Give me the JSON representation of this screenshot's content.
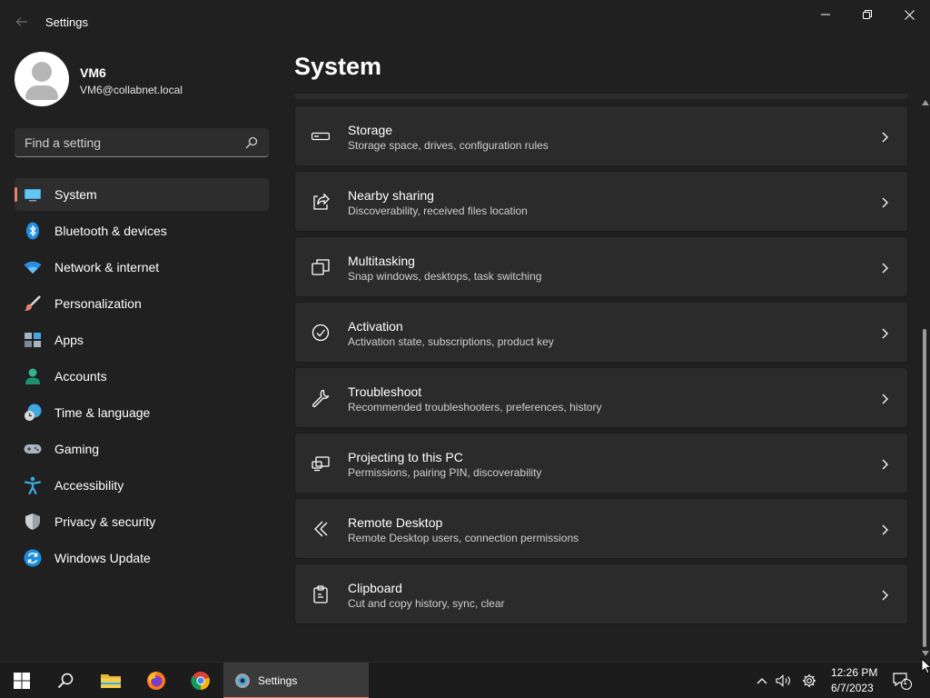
{
  "window": {
    "title": "Settings",
    "back_icon": "back-arrow-icon",
    "controls": [
      "minimize",
      "restore",
      "close"
    ]
  },
  "profile": {
    "name": "VM6",
    "email": "VM6@collabnet.local"
  },
  "search": {
    "placeholder": "Find a setting",
    "icon": "search-icon"
  },
  "sidebar": {
    "items": [
      {
        "label": "System",
        "icon": "system-icon",
        "active": true
      },
      {
        "label": "Bluetooth & devices",
        "icon": "bluetooth-icon"
      },
      {
        "label": "Network & internet",
        "icon": "wifi-icon"
      },
      {
        "label": "Personalization",
        "icon": "paintbrush-icon"
      },
      {
        "label": "Apps",
        "icon": "apps-icon"
      },
      {
        "label": "Accounts",
        "icon": "accounts-icon"
      },
      {
        "label": "Time & language",
        "icon": "clock-globe-icon"
      },
      {
        "label": "Gaming",
        "icon": "gamepad-icon"
      },
      {
        "label": "Accessibility",
        "icon": "accessibility-icon"
      },
      {
        "label": "Privacy & security",
        "icon": "shield-icon"
      },
      {
        "label": "Windows Update",
        "icon": "update-icon"
      }
    ],
    "accent_color": "#e8806c"
  },
  "main": {
    "title": "System",
    "cards": [
      {
        "title": "Storage",
        "subtitle": "Storage space, drives, configuration rules",
        "icon": "storage-icon"
      },
      {
        "title": "Nearby sharing",
        "subtitle": "Discoverability, received files location",
        "icon": "share-icon"
      },
      {
        "title": "Multitasking",
        "subtitle": "Snap windows, desktops, task switching",
        "icon": "multitasking-icon"
      },
      {
        "title": "Activation",
        "subtitle": "Activation state, subscriptions, product key",
        "icon": "checkmark-circle-icon"
      },
      {
        "title": "Troubleshoot",
        "subtitle": "Recommended troubleshooters, preferences, history",
        "icon": "wrench-icon"
      },
      {
        "title": "Projecting to this PC",
        "subtitle": "Permissions, pairing PIN, discoverability",
        "icon": "projecting-icon"
      },
      {
        "title": "Remote Desktop",
        "subtitle": "Remote Desktop users, connection permissions",
        "icon": "remote-desktop-icon"
      },
      {
        "title": "Clipboard",
        "subtitle": "Cut and copy history, sync, clear",
        "icon": "clipboard-icon"
      }
    ]
  },
  "taskbar": {
    "apps": [
      "start-icon",
      "search-icon",
      "file-explorer-icon",
      "firefox-icon",
      "chrome-icon"
    ],
    "active_app_label": "Settings",
    "tray_icons": [
      "chevron-up-icon",
      "volume-icon",
      "gear-icon",
      "notification-icon"
    ],
    "time": "12:26 PM",
    "date": "6/7/2023",
    "notification_count": "1"
  },
  "colors": {
    "background": "#202020",
    "card": "#2b2b2b",
    "accent": "#e8806c"
  }
}
